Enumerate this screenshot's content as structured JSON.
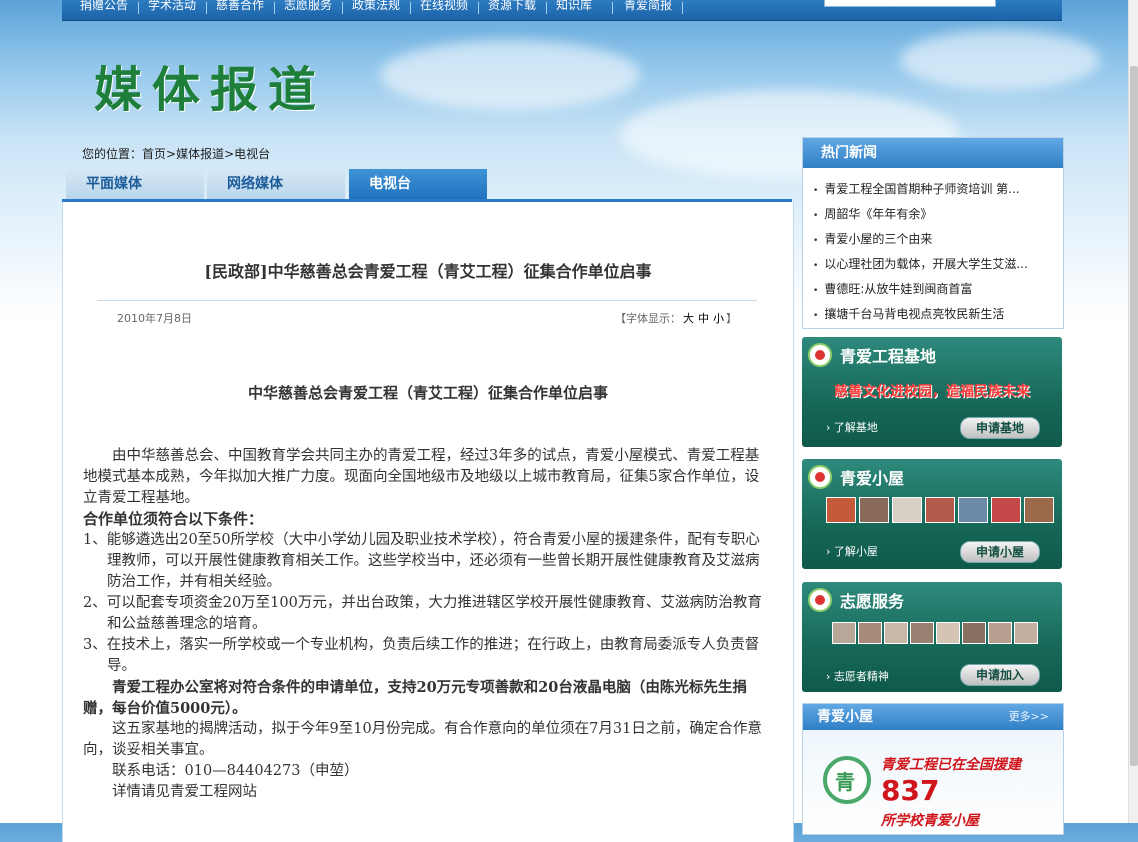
{
  "topnav": {
    "items": [
      "捐赠公告",
      "学术活动",
      "慈善合作",
      "志愿服务",
      "政策法规",
      "在线视频",
      "资源下载",
      "知识库",
      "青爱简报"
    ]
  },
  "page_title": "媒体报道",
  "breadcrumb": {
    "prefix": "您的位置：",
    "home": "首页",
    "sep": ">",
    "section": "媒体报道",
    "current": "电视台"
  },
  "tabs": [
    {
      "label": "平面媒体",
      "active": false
    },
    {
      "label": "网络媒体",
      "active": false
    },
    {
      "label": "电视台",
      "active": true
    }
  ],
  "article": {
    "title": "[民政部]中华慈善总会青爱工程（青艾工程）征集合作单位启事",
    "date": "2010年7月8日",
    "font_label": "【字体显示：",
    "font_options": [
      "大",
      "中",
      "小"
    ],
    "font_close": "】",
    "subtitle": "中华慈善总会青爱工程（青艾工程）征集合作单位启事",
    "intro": "由中华慈善总会、中国教育学会共同主办的青爱工程，经过3年多的试点，青爱小屋模式、青爱工程基地模式基本成熟，今年拟加大推广力度。现面向全国地级市及地级以上城市教育局，征集5家合作单位，设立青爱工程基地。",
    "cond_head": "合作单位须符合以下条件：",
    "conditions": [
      "1、能够遴选出20至50所学校（大中小学幼儿园及职业技术学校），符合青爱小屋的援建条件，配有专职心理教师，可以开展性健康教育相关工作。这些学校当中，还必须有一些曾长期开展性健康教育及艾滋病防治工作，并有相关经验。",
      "2、可以配套专项资金20万至100万元，并出台政策，大力推进辖区学校开展性健康教育、艾滋病防治教育和公益慈善理念的培育。",
      "3、在技术上，落实一所学校或一个专业机构，负责后续工作的推进；在行政上，由教育局委派专人负责督导。"
    ],
    "support": "青爱工程办公室将对符合条件的申请单位，支持20万元专项善款和20台液晶电脑（由陈光标先生捐赠，每台价值5000元）。",
    "activity": "这五家基地的揭牌活动，拟于今年9至10月份完成。有合作意向的单位须在7月31日之前，确定合作意向，谈妥相关事宜。",
    "contact": "联系电话：010—84404273（申堃）",
    "more": "详情请见青爱工程网站"
  },
  "hot_news": {
    "title": "热门新闻",
    "items": [
      "青爱工程全国首期种子师资培训 第...",
      "周韶华《年年有余》",
      "青爱小屋的三个由来",
      "以心理社团为载体，开展大学生艾滋...",
      "曹德旺:从放牛娃到闽商首富",
      "攘塘千台马背电视点亮牧民新生活"
    ]
  },
  "base_box": {
    "title": "青爱工程基地",
    "slogan": "慈善文化进校园，造福民族未来",
    "link": "了解基地",
    "button": "申请基地"
  },
  "house_box": {
    "title": "青爱小屋",
    "link": "了解小屋",
    "button": "申请小屋"
  },
  "volunteer_box": {
    "title": "志愿服务",
    "link": "志愿者精神",
    "button": "申请加入"
  },
  "qa_box": {
    "title": "青爱小屋",
    "more": "更多>>",
    "line1": "青爱工程已在全国援建",
    "number": "837",
    "line2": "所学校青爱小屋"
  },
  "colors": {
    "nav_blue": "#1c63a8",
    "title_green": "#1e7f3a",
    "tab_active": "#1f72bf",
    "panel_green": "#166857",
    "highlight_red": "#d0161c"
  }
}
